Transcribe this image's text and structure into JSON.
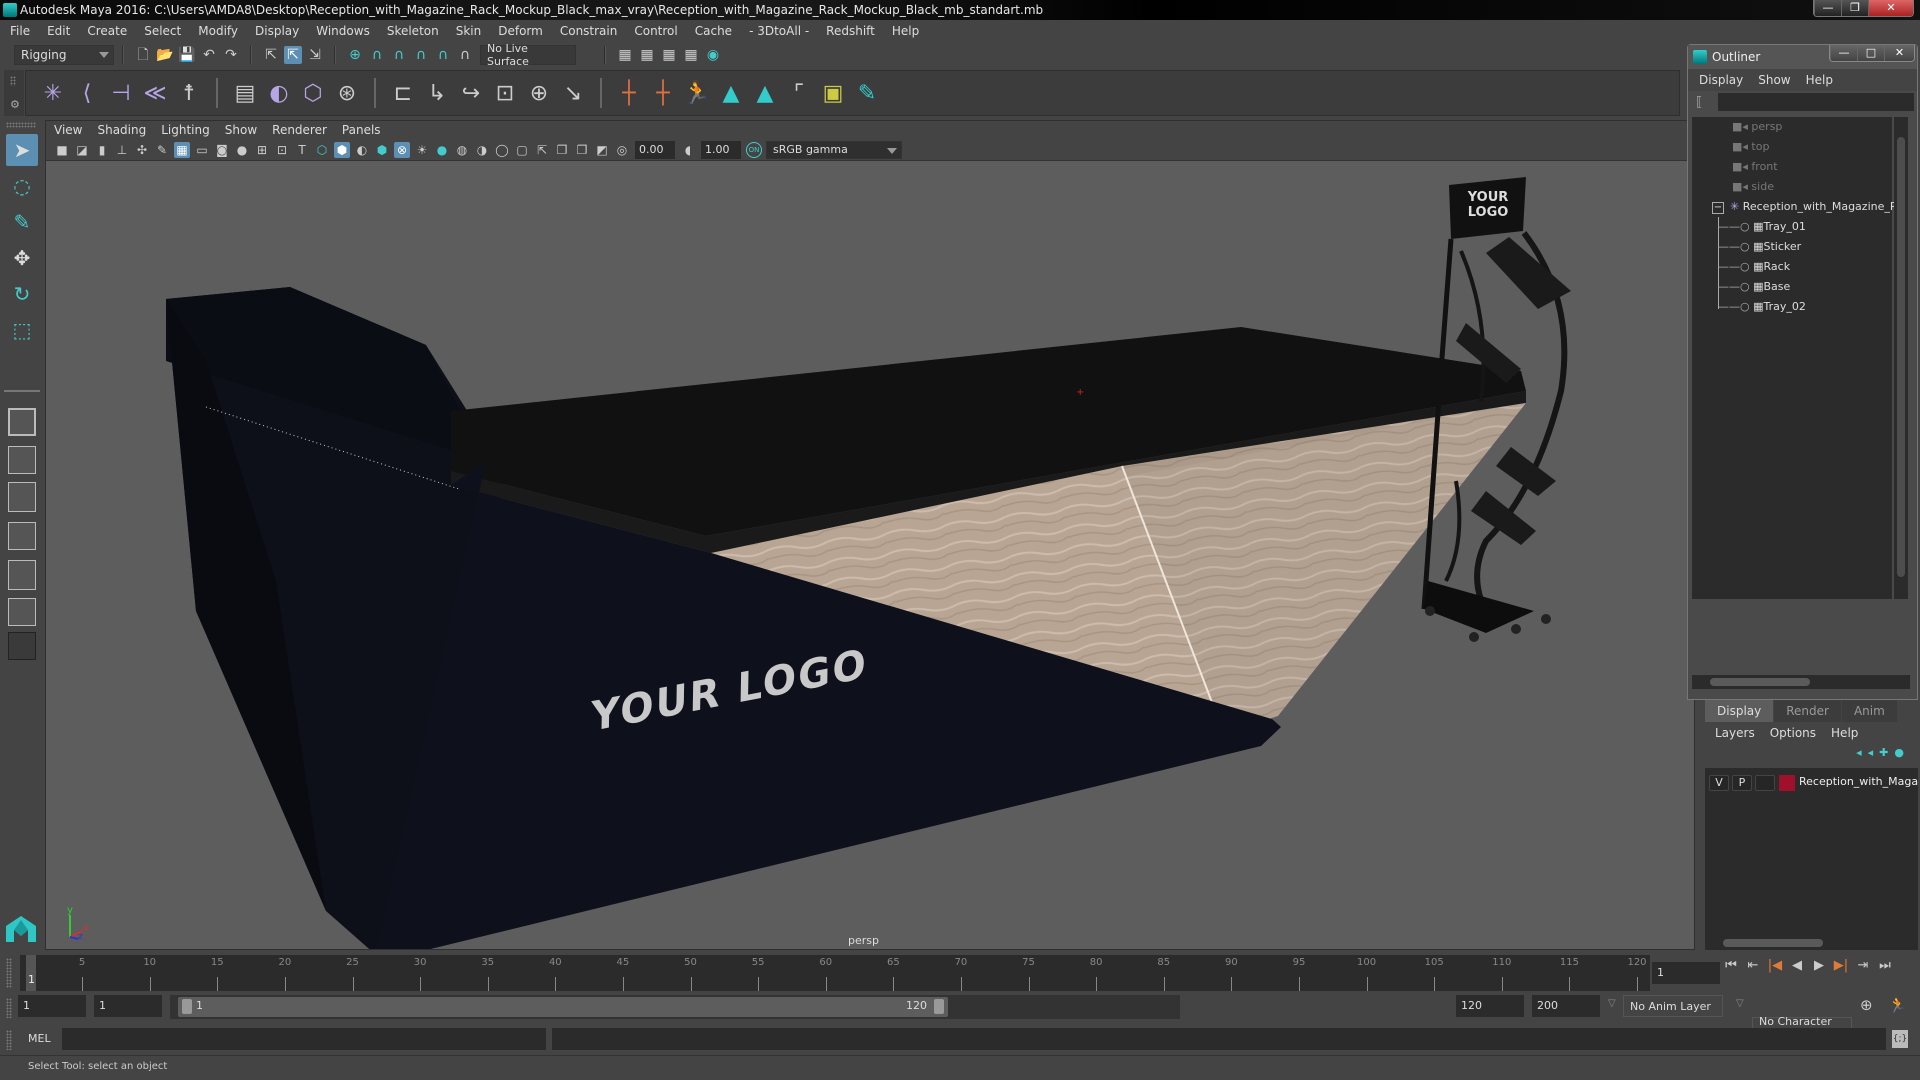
{
  "window": {
    "title": "Autodesk Maya 2016: C:\\Users\\AMDA8\\Desktop\\Reception_with_Magazine_Rack_Mockup_Black_max_vray\\Reception_with_Magazine_Rack_Mockup_Black_mb_standart.mb",
    "minimize": "—",
    "restore": "❐",
    "close": "✕"
  },
  "menubar": [
    "File",
    "Edit",
    "Create",
    "Select",
    "Modify",
    "Display",
    "Windows",
    "Skeleton",
    "Skin",
    "Deform",
    "Constrain",
    "Control",
    "Cache",
    "- 3DtoAll -",
    "Redshift",
    "Help"
  ],
  "statusline": {
    "menu_set": "Rigging",
    "live_surface": "No Live Surface",
    "icons": [
      "new-scene-icon",
      "open-scene-icon",
      "save-scene-icon",
      "undo-icon",
      "redo-icon",
      "select-hierarchy-icon",
      "select-object-icon",
      "select-component-icon",
      "snap-grid-icon",
      "snap-curve-icon",
      "snap-point-icon",
      "snap-projected-icon",
      "snap-view-plane-icon",
      "make-live-icon",
      "render-view-icon",
      "render-current-icon",
      "ipr-render-icon",
      "render-settings-icon",
      "hypershade-icon"
    ]
  },
  "shelf": {
    "icons": [
      "joint-tool-icon",
      "insert-joint-icon",
      "mirror-joint-icon",
      "ik-handle-icon",
      "humanik-icon",
      "bind-skin-icon",
      "smooth-bind-icon",
      "lattice-icon",
      "cluster-icon",
      "parent-constraint-icon",
      "point-constraint-icon",
      "orient-constraint-icon",
      "scale-constraint-icon",
      "aim-constraint-icon",
      "pole-vector-icon",
      "locator-icon",
      "parent-icon",
      "character-icon",
      "maya-m-icon",
      "maya-m2-icon",
      "blank-icon",
      "paint-weights-icon",
      "artisan-brush-icon"
    ]
  },
  "toolbox": {
    "tools": [
      "select-tool-icon",
      "lasso-tool-icon",
      "paint-select-icon",
      "move-tool-icon",
      "rotate-tool-icon",
      "scale-tool-icon"
    ],
    "layouts": [
      "single-perspective-layout",
      "four-view-layout",
      "persp-outliner-layout",
      "persp-graph-layout",
      "persp-hypergraph-layout",
      "persp-graph-outliner-layout",
      "more-layouts"
    ]
  },
  "viewport": {
    "menu": [
      "View",
      "Shading",
      "Lighting",
      "Show",
      "Renderer",
      "Panels"
    ],
    "exposure": "0.00",
    "gamma": "1.00",
    "color_space": "sRGB gamma",
    "color_mgmt": "ON",
    "camera_label": "persp",
    "scene_texts": {
      "desk_logo": "YOUR LOGO",
      "rack_logo_line1": "YOUR",
      "rack_logo_line2": "LOGO"
    },
    "axis": {
      "x": "x",
      "y": "y",
      "z": "z"
    }
  },
  "outliner": {
    "title": "Outliner",
    "menu": [
      "Display",
      "Show",
      "Help"
    ],
    "filter_value": "",
    "cameras": [
      "persp",
      "top",
      "front",
      "side"
    ],
    "root": "Reception_with_Magazine_R",
    "children": [
      "Tray_01",
      "Sticker",
      "Rack",
      "Base",
      "Tray_02"
    ]
  },
  "layers": {
    "tabs": [
      "Display",
      "Render",
      "Anim"
    ],
    "active_tab": "Display",
    "menu": [
      "Layers",
      "Options",
      "Help"
    ],
    "rows": [
      {
        "v": "V",
        "p": "P",
        "color": "#a0102a",
        "name": "Reception_with_Maga"
      }
    ]
  },
  "timeline": {
    "ticks": [
      5,
      10,
      15,
      20,
      25,
      30,
      35,
      40,
      45,
      50,
      55,
      60,
      65,
      70,
      75,
      80,
      85,
      90,
      95,
      100,
      105,
      110,
      115,
      120
    ],
    "min": 1,
    "max": 120,
    "current_frame": "1",
    "current_frame_field": "1",
    "playback_buttons": [
      "⏮",
      "⇤",
      "|◀",
      "◀",
      "▶",
      "▶|",
      "⇥",
      "⏭"
    ]
  },
  "range": {
    "start_field": "1",
    "anim_start_field": "1",
    "range_start": "1",
    "range_end": "120",
    "anim_end_field": "120",
    "playback_end_field": "200",
    "anim_layer": "No Anim Layer",
    "character_set": "No Character Set"
  },
  "commandline": {
    "label": "MEL",
    "input": "",
    "output": ""
  },
  "statusbar": {
    "message": "Select Tool: select an object"
  }
}
